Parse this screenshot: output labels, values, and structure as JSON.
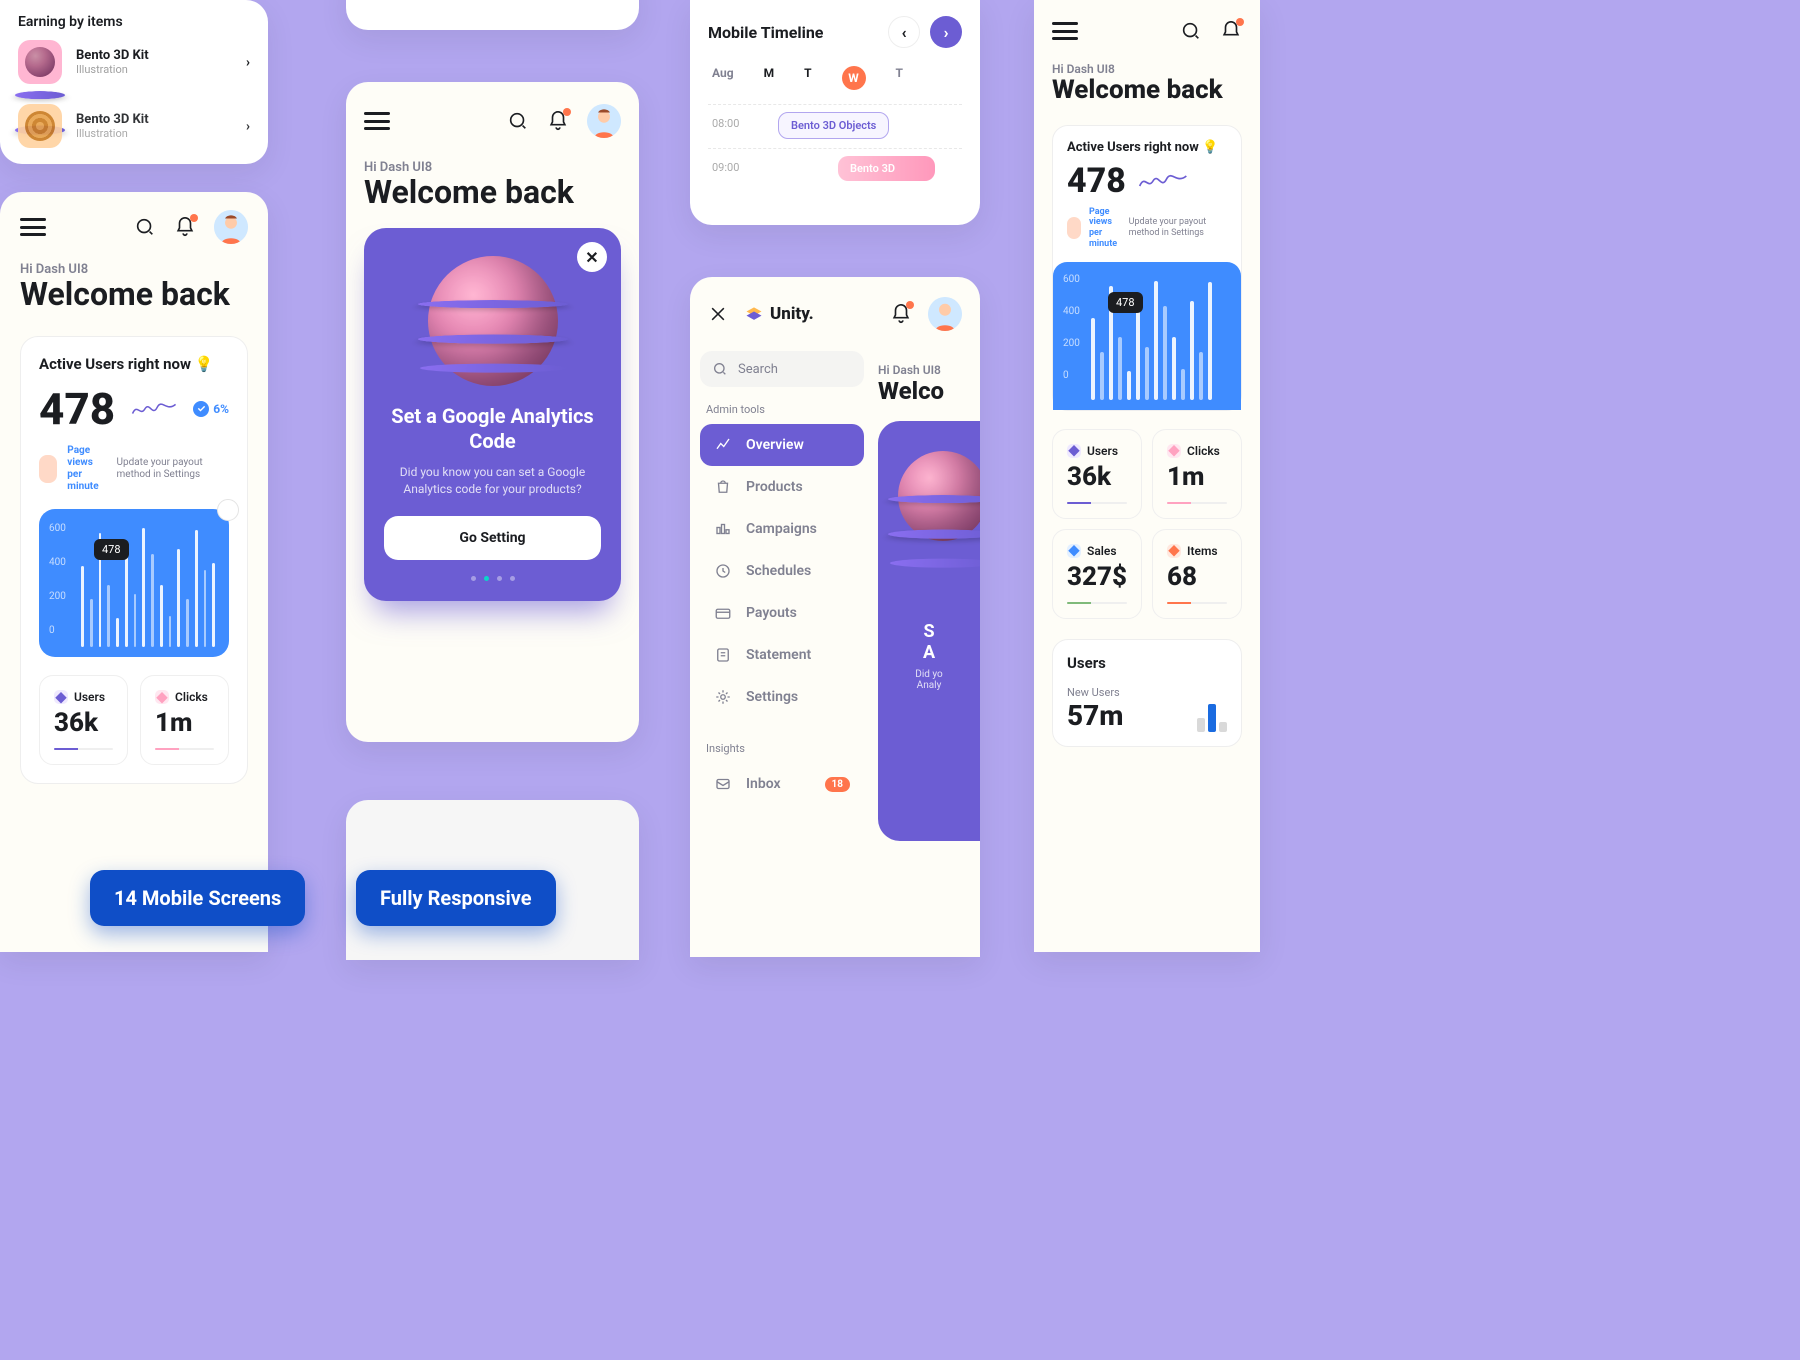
{
  "greet": {
    "hi": "Hi Dash UI8",
    "title": "Welcome back"
  },
  "earning": {
    "heading": "Earning by items",
    "items": [
      {
        "name": "Bento 3D Kit",
        "sub": "Illustration"
      },
      {
        "name": "Bento 3D Kit",
        "sub": "Illustration"
      }
    ]
  },
  "active_users": {
    "heading": "Active Users right now",
    "count": "478",
    "trend": "6%",
    "views_label": "Page views per minute",
    "hint": "Update your payout method in Settings"
  },
  "chart_data": {
    "type": "bar",
    "title": "Page views per minute",
    "ylim": [
      0,
      600
    ],
    "yticks": [
      0,
      200,
      400,
      600
    ],
    "highlight": {
      "index": 1,
      "value": 478,
      "label": "478"
    },
    "values": [
      350,
      478,
      260,
      120,
      440,
      220,
      510,
      400,
      260,
      130,
      420,
      200,
      500,
      320,
      350,
      220
    ]
  },
  "stats": [
    {
      "key": "Users",
      "val": "36k",
      "color": "#6c5dd3"
    },
    {
      "key": "Clicks",
      "val": "1m",
      "color": "#ffa2c0"
    },
    {
      "key": "Sales",
      "val": "327$",
      "color": "#3f8cff"
    },
    {
      "key": "Items",
      "val": "68",
      "color": "#ff754c"
    }
  ],
  "users_card": {
    "title": "Users",
    "sub": "New Users",
    "val": "57m"
  },
  "hero": {
    "title": "Set a Google Analytics Code",
    "desc": "Did you know you can set a Google Analytics code for your products?",
    "button": "Go Setting"
  },
  "timeline": {
    "title": "Mobile Timeline",
    "month": "Aug",
    "days": [
      "M",
      "T",
      "W",
      "T"
    ],
    "times": [
      "08:00",
      "09:00"
    ],
    "events": [
      {
        "label": "Bento 3D Objects"
      },
      {
        "label": "Bento 3D"
      }
    ]
  },
  "sidebar": {
    "brand": "Unity.",
    "search_ph": "Search",
    "group": "Admin tools",
    "items": [
      "Overview",
      "Products",
      "Campaigns",
      "Schedules",
      "Payouts",
      "Statement",
      "Settings"
    ],
    "insights": "Insights",
    "inbox": {
      "label": "Inbox",
      "count": "18"
    }
  },
  "chips": {
    "a": "14 Mobile Screens",
    "b": "Fully Responsive"
  }
}
